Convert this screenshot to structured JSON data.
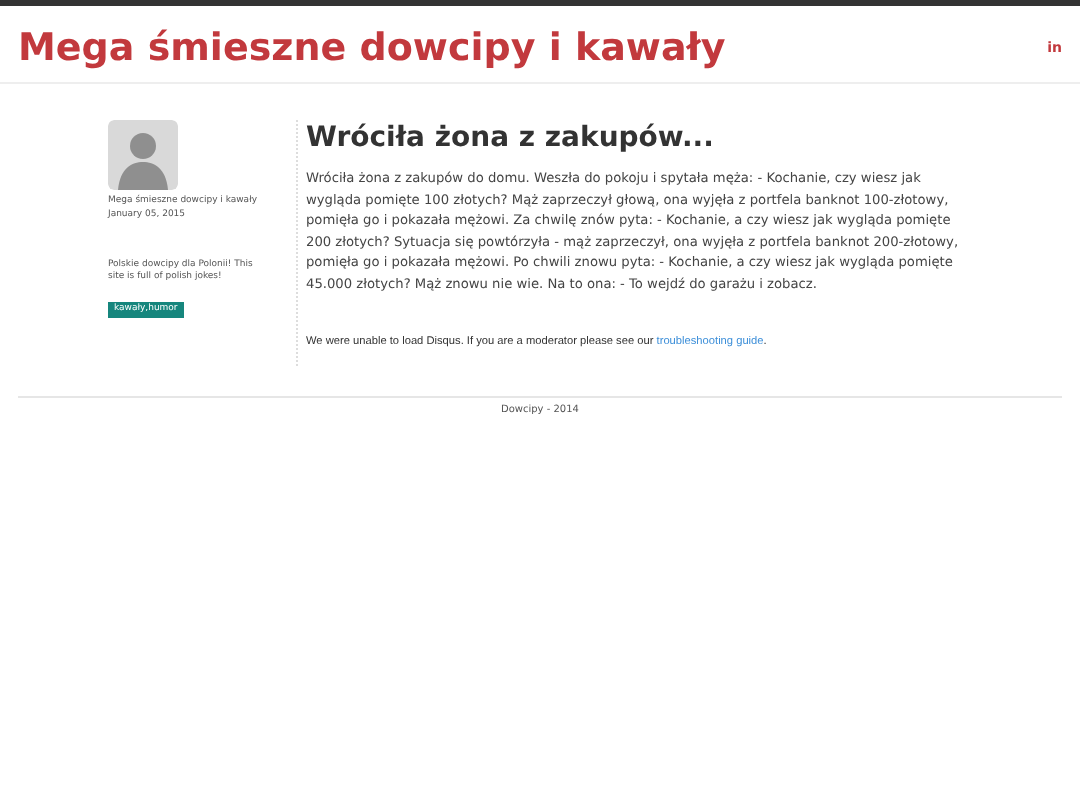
{
  "header": {
    "title": "Mega śmieszne dowcipy i kawały",
    "social": "in"
  },
  "sidebar": {
    "author": "Mega śmieszne dowcipy i kawały",
    "date": "January 05, 2015",
    "about": "Polskie dowcipy dla Polonii! This site is full of polish jokes!",
    "tag": "kawały,humor"
  },
  "post": {
    "title": "Wróciła żona z zakupów...",
    "body": "Wróciła żona z zakupów do domu. Weszła do pokoju i spytała męża: - Kochanie, czy wiesz jak wygląda pomięte 100 złotych? Mąż zaprzeczył głową, ona wyjęła z portfela banknot 100-złotowy, pomięła go i pokazała mężowi. Za chwilę znów pyta: - Kochanie, a czy wiesz jak wygląda pomięte 200 złotych? Sytuacja się powtórzyła - mąż zaprzeczył, ona wyjęła z portfela banknot 200-złotowy, pomięła go i pokazała mężowi. Po chwili znowu pyta: - Kochanie, a czy wiesz jak wygląda pomięte 45.000 złotych? Mąż znowu nie wie. Na to ona: - To wejdź do garażu i zobacz."
  },
  "disqus": {
    "message": "We were unable to load Disqus. If you are a moderator please see our",
    "link": "troubleshooting guide",
    "end": "."
  },
  "footer": "Dowcipy - 2014"
}
